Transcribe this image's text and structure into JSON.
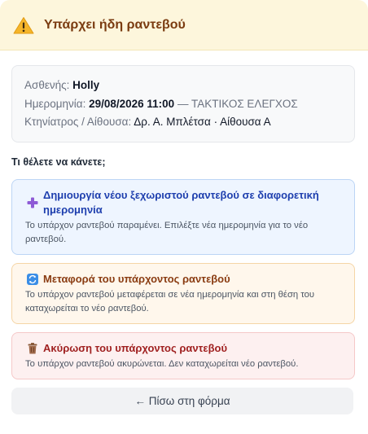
{
  "header": {
    "title": "Υπάρχει ήδη ραντεβού",
    "icon": "warning-icon",
    "bg_color": "#fdf6dc",
    "title_color": "#7a3b10"
  },
  "info": {
    "patient_label": "Ασθενής:",
    "patient_name": "Holly",
    "date_label": "Ημερομηνία:",
    "date_value": "29/08/2026 11:00",
    "separator": "—",
    "visit_type": "ΤΑΚΤΙΚΟΣ ΕΛΕΓΧΟΣ",
    "vet_label": "Κτηνίατρος / Αίθουσα:",
    "vet_value": "Δρ. Α. Μπλέτσα · Αίθουσα Α"
  },
  "question": "Τι θέλετε να κάνετε;",
  "options": [
    {
      "icon": "plus-icon",
      "glyph": "➕",
      "title": "Δημιουργία νέου ξεχωριστού ραντεβού σε διαφορετική ημερομηνία",
      "description": "Το υπάρχον ραντεβού παραμένει. Επιλέξτε νέα ημερομηνία για το νέο ραντεβού.",
      "color": "#1e3fae"
    },
    {
      "icon": "transfer-icon",
      "glyph": "🔄",
      "title": "Μεταφορά του υπάρχοντος ραντεβού",
      "description": "Το υπάρχον ραντεβού μεταφέρεται σε νέα ημερομηνία και στη θέση του καταχωρείται το νέο ραντεβού.",
      "color": "#8a3c12"
    },
    {
      "icon": "trash-icon",
      "glyph": "🗑",
      "title": "Ακύρωση του υπάρχοντος ραντεβού",
      "description": "Το υπάρχον ραντεβού ακυρώνεται. Δεν καταχωρείται νέο ραντεβού.",
      "color": "#9f1f1f"
    }
  ],
  "back_button": "← Πίσω στη φόρμα"
}
